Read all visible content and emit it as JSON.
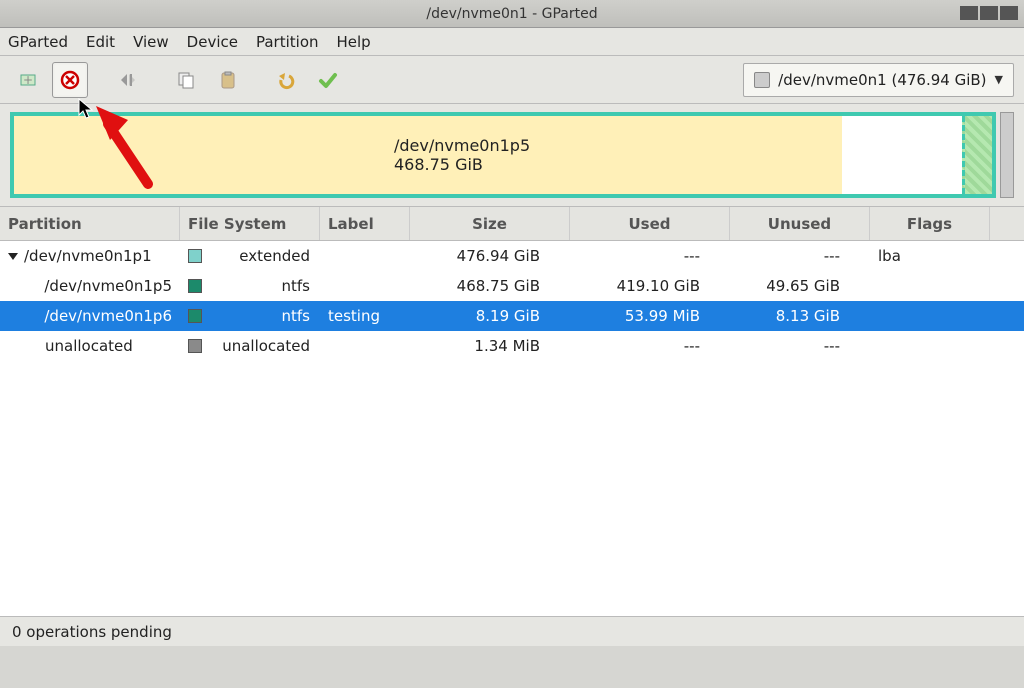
{
  "window": {
    "title": "/dev/nvme0n1 - GParted"
  },
  "menubar": {
    "items": [
      "GParted",
      "Edit",
      "View",
      "Device",
      "Partition",
      "Help"
    ]
  },
  "toolbar": {
    "new_label": "New",
    "delete_label": "Delete",
    "resize_label": "Resize/Move",
    "copy_label": "Copy",
    "paste_label": "Paste",
    "undo_label": "Undo",
    "apply_label": "Apply"
  },
  "device_combo": {
    "text": "/dev/nvme0n1 (476.94 GiB)"
  },
  "disk_visual": {
    "primary_label_name": "/dev/nvme0n1p5",
    "primary_label_size": "468.75 GiB"
  },
  "columns": {
    "partition": "Partition",
    "filesystem": "File System",
    "label": "Label",
    "size": "Size",
    "used": "Used",
    "unused": "Unused",
    "flags": "Flags"
  },
  "rows": [
    {
      "partition": "/dev/nvme0n1p1",
      "indent": 0,
      "expander": true,
      "swatch": "sw-ext",
      "fs": "extended",
      "label": "",
      "size": "476.94 GiB",
      "used": "---",
      "unused": "---",
      "flags": "lba",
      "selected": false
    },
    {
      "partition": "/dev/nvme0n1p5",
      "indent": 1,
      "expander": false,
      "swatch": "sw-ntfs",
      "fs": "ntfs",
      "label": "",
      "size": "468.75 GiB",
      "used": "419.10 GiB",
      "unused": "49.65 GiB",
      "flags": "",
      "selected": false
    },
    {
      "partition": "/dev/nvme0n1p6",
      "indent": 1,
      "expander": false,
      "swatch": "sw-ntfs",
      "fs": "ntfs",
      "label": "testing",
      "size": "8.19 GiB",
      "used": "53.99 MiB",
      "unused": "8.13 GiB",
      "flags": "",
      "selected": true
    },
    {
      "partition": "unallocated",
      "indent": 1,
      "expander": false,
      "swatch": "sw-un",
      "fs": "unallocated",
      "label": "",
      "size": "1.34 MiB",
      "used": "---",
      "unused": "---",
      "flags": "",
      "selected": false
    }
  ],
  "statusbar": {
    "text": "0 operations pending"
  }
}
